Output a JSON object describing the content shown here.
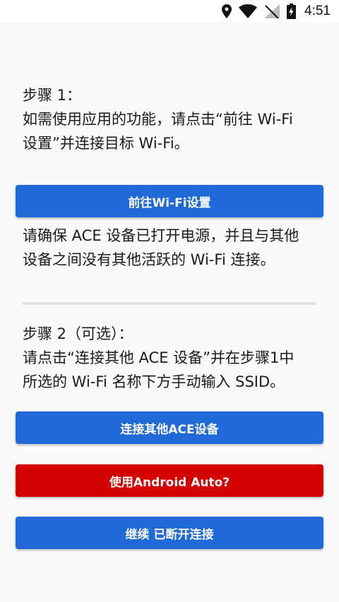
{
  "status_bar": {
    "time": "4:51"
  },
  "step1": {
    "heading": "步骤 1：",
    "line1": "如需使用应用的功能，请点击“前往 Wi-Fi",
    "line2": "设置”并连接目标 Wi-Fi。"
  },
  "wifi_settings_button": {
    "label": "前往Wi-Fi设置"
  },
  "step1_note": {
    "line1": "请确保 ACE 设备已打开电源，并且与其他",
    "line2": "设备之间没有其他活跃的 Wi-Fi 连接。"
  },
  "step2": {
    "heading": "步骤 2（可选）：",
    "line1": "请点击“连接其他 ACE 设备”并在步骤1中",
    "line2": "所选的 Wi-Fi 名称下方手动输入 SSID。"
  },
  "connect_other_button": {
    "label": "连接其他ACE设备"
  },
  "android_auto_button": {
    "label": "使用Android Auto?"
  },
  "continue_button": {
    "label": "继续 已断开连接"
  },
  "colors": {
    "primary_blue": "#1f6ad6",
    "alert_red": "#d40000",
    "background": "#fafafa"
  }
}
